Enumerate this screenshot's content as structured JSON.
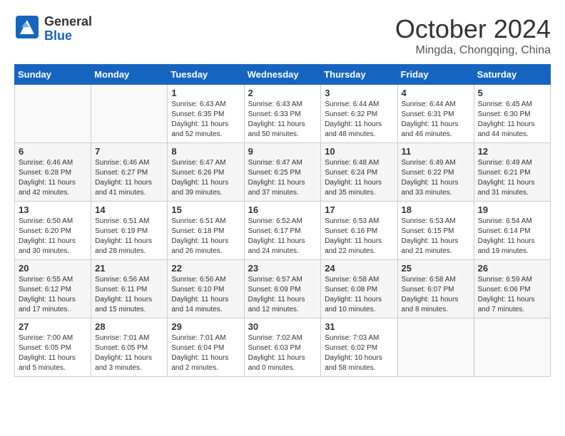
{
  "header": {
    "logo_general": "General",
    "logo_blue": "Blue",
    "month_title": "October 2024",
    "location": "Mingda, Chongqing, China"
  },
  "weekdays": [
    "Sunday",
    "Monday",
    "Tuesday",
    "Wednesday",
    "Thursday",
    "Friday",
    "Saturday"
  ],
  "weeks": [
    [
      {
        "day": "",
        "sunrise": "",
        "sunset": "",
        "daylight": ""
      },
      {
        "day": "",
        "sunrise": "",
        "sunset": "",
        "daylight": ""
      },
      {
        "day": "1",
        "sunrise": "Sunrise: 6:43 AM",
        "sunset": "Sunset: 6:35 PM",
        "daylight": "Daylight: 11 hours and 52 minutes."
      },
      {
        "day": "2",
        "sunrise": "Sunrise: 6:43 AM",
        "sunset": "Sunset: 6:33 PM",
        "daylight": "Daylight: 11 hours and 50 minutes."
      },
      {
        "day": "3",
        "sunrise": "Sunrise: 6:44 AM",
        "sunset": "Sunset: 6:32 PM",
        "daylight": "Daylight: 11 hours and 48 minutes."
      },
      {
        "day": "4",
        "sunrise": "Sunrise: 6:44 AM",
        "sunset": "Sunset: 6:31 PM",
        "daylight": "Daylight: 11 hours and 46 minutes."
      },
      {
        "day": "5",
        "sunrise": "Sunrise: 6:45 AM",
        "sunset": "Sunset: 6:30 PM",
        "daylight": "Daylight: 11 hours and 44 minutes."
      }
    ],
    [
      {
        "day": "6",
        "sunrise": "Sunrise: 6:46 AM",
        "sunset": "Sunset: 6:28 PM",
        "daylight": "Daylight: 11 hours and 42 minutes."
      },
      {
        "day": "7",
        "sunrise": "Sunrise: 6:46 AM",
        "sunset": "Sunset: 6:27 PM",
        "daylight": "Daylight: 11 hours and 41 minutes."
      },
      {
        "day": "8",
        "sunrise": "Sunrise: 6:47 AM",
        "sunset": "Sunset: 6:26 PM",
        "daylight": "Daylight: 11 hours and 39 minutes."
      },
      {
        "day": "9",
        "sunrise": "Sunrise: 6:47 AM",
        "sunset": "Sunset: 6:25 PM",
        "daylight": "Daylight: 11 hours and 37 minutes."
      },
      {
        "day": "10",
        "sunrise": "Sunrise: 6:48 AM",
        "sunset": "Sunset: 6:24 PM",
        "daylight": "Daylight: 11 hours and 35 minutes."
      },
      {
        "day": "11",
        "sunrise": "Sunrise: 6:49 AM",
        "sunset": "Sunset: 6:22 PM",
        "daylight": "Daylight: 11 hours and 33 minutes."
      },
      {
        "day": "12",
        "sunrise": "Sunrise: 6:49 AM",
        "sunset": "Sunset: 6:21 PM",
        "daylight": "Daylight: 11 hours and 31 minutes."
      }
    ],
    [
      {
        "day": "13",
        "sunrise": "Sunrise: 6:50 AM",
        "sunset": "Sunset: 6:20 PM",
        "daylight": "Daylight: 11 hours and 30 minutes."
      },
      {
        "day": "14",
        "sunrise": "Sunrise: 6:51 AM",
        "sunset": "Sunset: 6:19 PM",
        "daylight": "Daylight: 11 hours and 28 minutes."
      },
      {
        "day": "15",
        "sunrise": "Sunrise: 6:51 AM",
        "sunset": "Sunset: 6:18 PM",
        "daylight": "Daylight: 11 hours and 26 minutes."
      },
      {
        "day": "16",
        "sunrise": "Sunrise: 6:52 AM",
        "sunset": "Sunset: 6:17 PM",
        "daylight": "Daylight: 11 hours and 24 minutes."
      },
      {
        "day": "17",
        "sunrise": "Sunrise: 6:53 AM",
        "sunset": "Sunset: 6:16 PM",
        "daylight": "Daylight: 11 hours and 22 minutes."
      },
      {
        "day": "18",
        "sunrise": "Sunrise: 6:53 AM",
        "sunset": "Sunset: 6:15 PM",
        "daylight": "Daylight: 11 hours and 21 minutes."
      },
      {
        "day": "19",
        "sunrise": "Sunrise: 6:54 AM",
        "sunset": "Sunset: 6:14 PM",
        "daylight": "Daylight: 11 hours and 19 minutes."
      }
    ],
    [
      {
        "day": "20",
        "sunrise": "Sunrise: 6:55 AM",
        "sunset": "Sunset: 6:12 PM",
        "daylight": "Daylight: 11 hours and 17 minutes."
      },
      {
        "day": "21",
        "sunrise": "Sunrise: 6:56 AM",
        "sunset": "Sunset: 6:11 PM",
        "daylight": "Daylight: 11 hours and 15 minutes."
      },
      {
        "day": "22",
        "sunrise": "Sunrise: 6:56 AM",
        "sunset": "Sunset: 6:10 PM",
        "daylight": "Daylight: 11 hours and 14 minutes."
      },
      {
        "day": "23",
        "sunrise": "Sunrise: 6:57 AM",
        "sunset": "Sunset: 6:09 PM",
        "daylight": "Daylight: 11 hours and 12 minutes."
      },
      {
        "day": "24",
        "sunrise": "Sunrise: 6:58 AM",
        "sunset": "Sunset: 6:08 PM",
        "daylight": "Daylight: 11 hours and 10 minutes."
      },
      {
        "day": "25",
        "sunrise": "Sunrise: 6:58 AM",
        "sunset": "Sunset: 6:07 PM",
        "daylight": "Daylight: 11 hours and 8 minutes."
      },
      {
        "day": "26",
        "sunrise": "Sunrise: 6:59 AM",
        "sunset": "Sunset: 6:06 PM",
        "daylight": "Daylight: 11 hours and 7 minutes."
      }
    ],
    [
      {
        "day": "27",
        "sunrise": "Sunrise: 7:00 AM",
        "sunset": "Sunset: 6:05 PM",
        "daylight": "Daylight: 11 hours and 5 minutes."
      },
      {
        "day": "28",
        "sunrise": "Sunrise: 7:01 AM",
        "sunset": "Sunset: 6:05 PM",
        "daylight": "Daylight: 11 hours and 3 minutes."
      },
      {
        "day": "29",
        "sunrise": "Sunrise: 7:01 AM",
        "sunset": "Sunset: 6:04 PM",
        "daylight": "Daylight: 11 hours and 2 minutes."
      },
      {
        "day": "30",
        "sunrise": "Sunrise: 7:02 AM",
        "sunset": "Sunset: 6:03 PM",
        "daylight": "Daylight: 11 hours and 0 minutes."
      },
      {
        "day": "31",
        "sunrise": "Sunrise: 7:03 AM",
        "sunset": "Sunset: 6:02 PM",
        "daylight": "Daylight: 10 hours and 58 minutes."
      },
      {
        "day": "",
        "sunrise": "",
        "sunset": "",
        "daylight": ""
      },
      {
        "day": "",
        "sunrise": "",
        "sunset": "",
        "daylight": ""
      }
    ]
  ]
}
